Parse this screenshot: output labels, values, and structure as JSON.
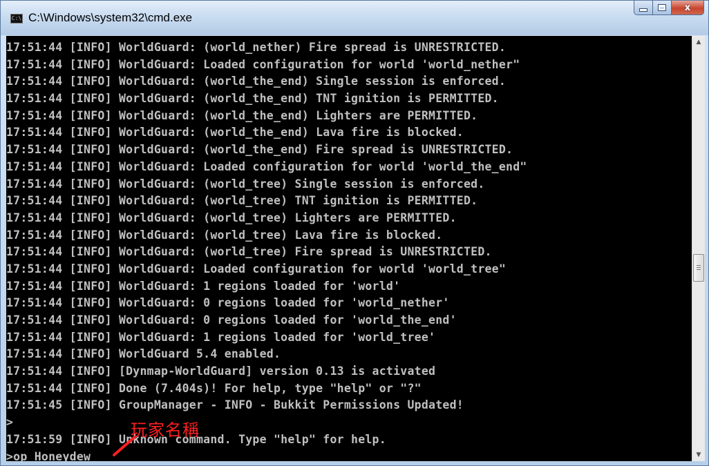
{
  "window": {
    "title": "C:\\Windows\\system32\\cmd.exe",
    "icon": "console-icon",
    "icon_text": "C:\\"
  },
  "controls": {
    "minimize_icon": "minimize-icon",
    "maximize_icon": "maximize-icon",
    "close_icon": "close-icon",
    "close_label": "x"
  },
  "console": {
    "background": "#000000",
    "text_color": "#c0c0c0",
    "lines": [
      "17:51:44 [INFO] WorldGuard: (world_nether) Fire spread is UNRESTRICTED.",
      "17:51:44 [INFO] WorldGuard: Loaded configuration for world 'world_nether\"",
      "17:51:44 [INFO] WorldGuard: (world_the_end) Single session is enforced.",
      "17:51:44 [INFO] WorldGuard: (world_the_end) TNT ignition is PERMITTED.",
      "17:51:44 [INFO] WorldGuard: (world_the_end) Lighters are PERMITTED.",
      "17:51:44 [INFO] WorldGuard: (world_the_end) Lava fire is blocked.",
      "17:51:44 [INFO] WorldGuard: (world_the_end) Fire spread is UNRESTRICTED.",
      "17:51:44 [INFO] WorldGuard: Loaded configuration for world 'world_the_end\"",
      "17:51:44 [INFO] WorldGuard: (world_tree) Single session is enforced.",
      "17:51:44 [INFO] WorldGuard: (world_tree) TNT ignition is PERMITTED.",
      "17:51:44 [INFO] WorldGuard: (world_tree) Lighters are PERMITTED.",
      "17:51:44 [INFO] WorldGuard: (world_tree) Lava fire is blocked.",
      "17:51:44 [INFO] WorldGuard: (world_tree) Fire spread is UNRESTRICTED.",
      "17:51:44 [INFO] WorldGuard: Loaded configuration for world 'world_tree\"",
      "17:51:44 [INFO] WorldGuard: 1 regions loaded for 'world'",
      "17:51:44 [INFO] WorldGuard: 0 regions loaded for 'world_nether'",
      "17:51:44 [INFO] WorldGuard: 0 regions loaded for 'world_the_end'",
      "17:51:44 [INFO] WorldGuard: 1 regions loaded for 'world_tree'",
      "17:51:44 [INFO] WorldGuard 5.4 enabled.",
      "17:51:44 [INFO] [Dynmap-WorldGuard] version 0.13 is activated",
      "17:51:44 [INFO] Done (7.404s)! For help, type \"help\" or \"?\"",
      "17:51:45 [INFO] GroupManager - INFO - Bukkit Permissions Updated!",
      ">",
      "17:51:59 [INFO] Unknown command. Type \"help\" for help.",
      ">op Honeydew"
    ]
  },
  "scrollbar": {
    "up_icon": "scroll-up-arrow-icon",
    "down_icon": "scroll-down-arrow-icon",
    "up_glyph": "▲",
    "down_glyph": "▼"
  },
  "annotation": {
    "text": "玩家名稱",
    "color": "#ff2020",
    "icon": "red-arrow-icon"
  }
}
